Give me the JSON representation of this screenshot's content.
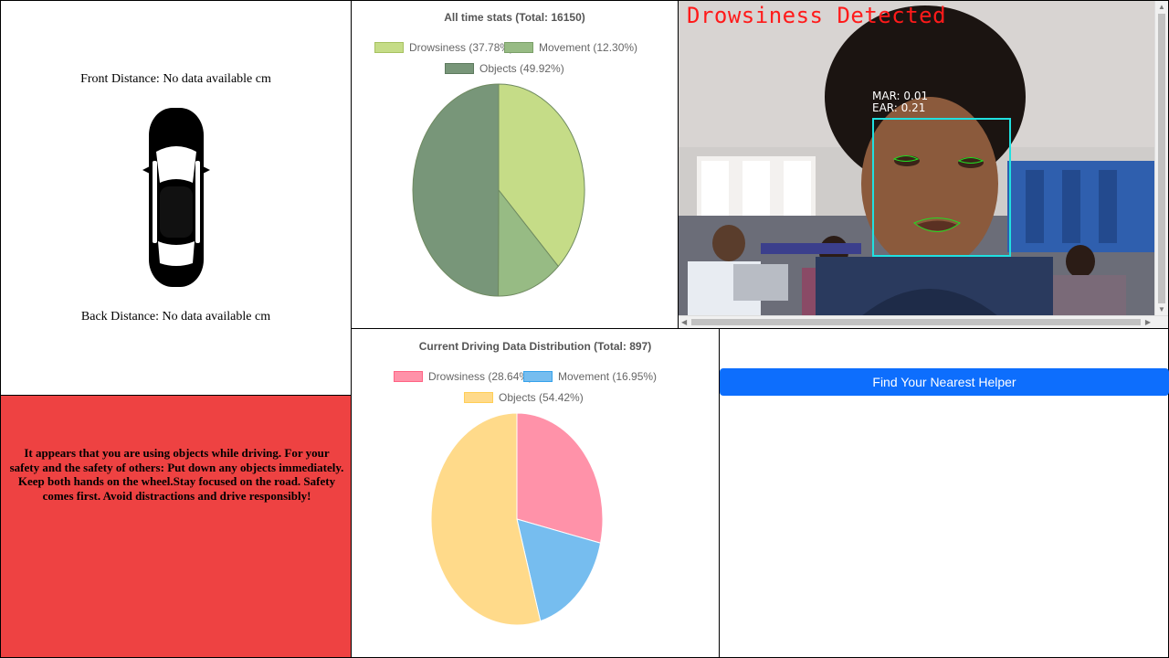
{
  "sensors": {
    "front_distance": "Front Distance: No data available cm",
    "back_distance": "Back Distance: No data available cm",
    "car_icon": "car-top-view-icon"
  },
  "alltime_stats": {
    "title": "All time stats (Total: 16150)",
    "legend": [
      {
        "label": "Drowsiness (37.78%)",
        "color": "#c5dc87"
      },
      {
        "label": "Movement (12.30%)",
        "color": "#97bb84"
      },
      {
        "label": "Objects (49.92%)",
        "color": "#789679"
      }
    ]
  },
  "current_stats": {
    "title": "Current Driving Data Distribution (Total: 897)",
    "legend": [
      {
        "label": "Drowsiness (28.64%)",
        "color": "#ff92a9"
      },
      {
        "label": "Movement (16.95%)",
        "color": "#76bdef"
      },
      {
        "label": "Objects (54.42%)",
        "color": "#ffda8a"
      }
    ]
  },
  "camera": {
    "status_text": "Drowsiness Detected",
    "mar_text": "MAR: 0.01",
    "ear_text": "EAR: 0.21",
    "box_color": "#20e0e0",
    "landmark_color": "#22dd22"
  },
  "alert": {
    "message": "It appears that you are using objects while driving. For your safety and the safety of others: Put down any objects immediately. Keep both hands on the wheel.Stay focused on the road. Safety comes first. Avoid distractions and drive responsibly!",
    "background": "#ee4242"
  },
  "helper": {
    "button_label": "Find Your Nearest Helper",
    "button_color": "#0d6efd"
  },
  "chart_data": [
    {
      "type": "pie",
      "title": "All time stats (Total: 16150)",
      "categories": [
        "Drowsiness (37.78%)",
        "Movement (12.30%)",
        "Objects (49.92%)"
      ],
      "values": [
        37.78,
        12.3,
        49.92
      ],
      "colors": [
        "#c5dc87",
        "#97bb84",
        "#789679"
      ],
      "legend_position": "top"
    },
    {
      "type": "pie",
      "title": "Current Driving Data Distribution (Total: 897)",
      "categories": [
        "Drowsiness (28.64%)",
        "Movement (16.95%)",
        "Objects (54.42%)"
      ],
      "values": [
        28.64,
        16.95,
        54.42
      ],
      "colors": [
        "#ff92a9",
        "#76bdef",
        "#ffda8a"
      ],
      "legend_position": "top"
    }
  ]
}
